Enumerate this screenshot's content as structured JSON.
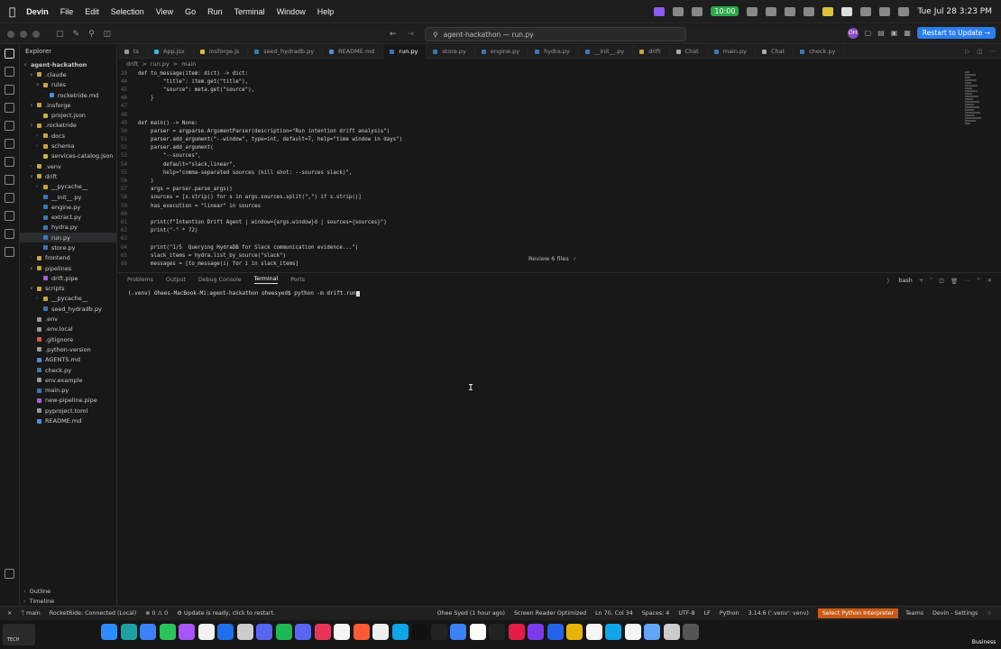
{
  "menubar": {
    "app_name": "Devin",
    "items": [
      "File",
      "Edit",
      "Selection",
      "View",
      "Go",
      "Run",
      "Terminal",
      "Window",
      "Help"
    ],
    "tray_time_badge": "10:00",
    "datetime": "Tue Jul 28  3:23 PM"
  },
  "titlebar": {
    "search_text": "agent-hackathon — run.py",
    "restart_label": "Restart to Update →",
    "avatar_initials": "OH"
  },
  "explorer": {
    "title": "Explorer",
    "tree": [
      {
        "label": "agent-hackathon",
        "indent": 0,
        "chev": "v",
        "type": "root"
      },
      {
        "label": ".claude",
        "indent": 1,
        "chev": "v",
        "type": "folder"
      },
      {
        "label": "rules",
        "indent": 2,
        "chev": "v",
        "type": "folder"
      },
      {
        "label": "rocketride.md",
        "indent": 3,
        "chev": "",
        "type": "md"
      },
      {
        "label": ".insforge",
        "indent": 1,
        "chev": "v",
        "type": "folder"
      },
      {
        "label": "project.json",
        "indent": 2,
        "chev": "",
        "type": "json"
      },
      {
        "label": ".rocketride",
        "indent": 1,
        "chev": "v",
        "type": "folder"
      },
      {
        "label": "docs",
        "indent": 2,
        "chev": ">",
        "type": "folder"
      },
      {
        "label": "schema",
        "indent": 2,
        "chev": ">",
        "type": "folder"
      },
      {
        "label": "services-catalog.json",
        "indent": 2,
        "chev": "",
        "type": "json"
      },
      {
        "label": ".venv",
        "indent": 1,
        "chev": ">",
        "type": "folder"
      },
      {
        "label": "drift",
        "indent": 1,
        "chev": "v",
        "type": "folder"
      },
      {
        "label": "__pycache__",
        "indent": 2,
        "chev": ">",
        "type": "folder"
      },
      {
        "label": "__init__.py",
        "indent": 2,
        "chev": "",
        "type": "py"
      },
      {
        "label": "engine.py",
        "indent": 2,
        "chev": "",
        "type": "py"
      },
      {
        "label": "extract.py",
        "indent": 2,
        "chev": "",
        "type": "py"
      },
      {
        "label": "hydra.py",
        "indent": 2,
        "chev": "",
        "type": "py"
      },
      {
        "label": "run.py",
        "indent": 2,
        "chev": "",
        "type": "py",
        "selected": true
      },
      {
        "label": "store.py",
        "indent": 2,
        "chev": "",
        "type": "py"
      },
      {
        "label": "frontend",
        "indent": 1,
        "chev": ">",
        "type": "folder"
      },
      {
        "label": "pipelines",
        "indent": 1,
        "chev": "v",
        "type": "folder"
      },
      {
        "label": "drift.pipe",
        "indent": 2,
        "chev": "",
        "type": "pipe"
      },
      {
        "label": "scripts",
        "indent": 1,
        "chev": "v",
        "type": "folder"
      },
      {
        "label": "__pycache__",
        "indent": 2,
        "chev": ">",
        "type": "folder"
      },
      {
        "label": "seed_hydradb.py",
        "indent": 2,
        "chev": "",
        "type": "py"
      },
      {
        "label": ".env",
        "indent": 1,
        "chev": "",
        "type": "env"
      },
      {
        "label": ".env.local",
        "indent": 1,
        "chev": "",
        "type": "env"
      },
      {
        "label": ".gitignore",
        "indent": 1,
        "chev": "",
        "type": "git"
      },
      {
        "label": ".python-version",
        "indent": 1,
        "chev": "",
        "type": "env"
      },
      {
        "label": "AGENTS.md",
        "indent": 1,
        "chev": "",
        "type": "md"
      },
      {
        "label": "check.py",
        "indent": 1,
        "chev": "",
        "type": "py"
      },
      {
        "label": "env.example",
        "indent": 1,
        "chev": "",
        "type": "env"
      },
      {
        "label": "main.py",
        "indent": 1,
        "chev": "",
        "type": "py"
      },
      {
        "label": "new-pipeline.pipe",
        "indent": 1,
        "chev": "",
        "type": "pipe"
      },
      {
        "label": "pyproject.toml",
        "indent": 1,
        "chev": "",
        "type": "env"
      },
      {
        "label": "README.md",
        "indent": 1,
        "chev": "",
        "type": "md"
      }
    ],
    "bottom_sections": [
      "Outline",
      "Timeline"
    ]
  },
  "tabs": [
    {
      "label": "ts",
      "type": "env"
    },
    {
      "label": "App.jsx",
      "type": "jsx"
    },
    {
      "label": "insforge.js",
      "type": "js"
    },
    {
      "label": "seed_hydradb.py",
      "type": "py"
    },
    {
      "label": "README.md",
      "type": "md"
    },
    {
      "label": "run.py",
      "type": "py",
      "active": true
    },
    {
      "label": "store.py",
      "type": "py"
    },
    {
      "label": "engine.py",
      "type": "py"
    },
    {
      "label": "hydra.py",
      "type": "py"
    },
    {
      "label": "__init__.py",
      "type": "py"
    },
    {
      "label": "drift",
      "type": "folder"
    },
    {
      "label": "Chat",
      "type": "chat"
    },
    {
      "label": "main.py",
      "type": "py"
    },
    {
      "label": "Chat",
      "type": "chat"
    },
    {
      "label": "check.py",
      "type": "py"
    }
  ],
  "breadcrumb": [
    "drift",
    ">",
    "run.py",
    ">",
    "main"
  ],
  "code_lines": [
    {
      "n": "29",
      "t": "def to_message(item: dict) -> dict:"
    },
    {
      "n": "44",
      "t": "        \"title\": item.get(\"title\"),"
    },
    {
      "n": "45",
      "t": "        \"source\": meta.get(\"source\"),"
    },
    {
      "n": "46",
      "t": "    }"
    },
    {
      "n": "47",
      "t": ""
    },
    {
      "n": "48",
      "t": ""
    },
    {
      "n": "49",
      "t": "def main() -> None:"
    },
    {
      "n": "50",
      "t": "    parser = argparse.ArgumentParser(description=\"Run intention drift analysis\")"
    },
    {
      "n": "51",
      "t": "    parser.add_argument(\"--window\", type=int, default=7, help=\"time window in days\")"
    },
    {
      "n": "52",
      "t": "    parser.add_argument("
    },
    {
      "n": "53",
      "t": "        \"--sources\","
    },
    {
      "n": "54",
      "t": "        default=\"slack,linear\","
    },
    {
      "n": "55",
      "t": "        help=\"comma-separated sources (kill shot: --sources slack)\","
    },
    {
      "n": "56",
      "t": "    )"
    },
    {
      "n": "57",
      "t": "    args = parser.parse_args()"
    },
    {
      "n": "58",
      "t": "    sources = [s.strip() for s in args.sources.split(\",\") if s.strip()]"
    },
    {
      "n": "59",
      "t": "    has_execution = \"linear\" in sources"
    },
    {
      "n": "60",
      "t": ""
    },
    {
      "n": "61",
      "t": "    print(f\"Intention Drift Agent | window={args.window}d | sources={sources}\")"
    },
    {
      "n": "62",
      "t": "    print(\"-\" * 72)"
    },
    {
      "n": "63",
      "t": ""
    },
    {
      "n": "64",
      "t": "    print(\"1/5  Querying HydraDB for Slack communication evidence...\")"
    },
    {
      "n": "65",
      "t": "    slack_items = hydra.list_by_source(\"slack\")"
    },
    {
      "n": "66",
      "t": "    messages = [to_message(i) for i in slack_items]"
    }
  ],
  "review": {
    "label": "Review 6 files"
  },
  "panel": {
    "tabs": [
      "Problems",
      "Output",
      "Debug Console",
      "Terminal",
      "Ports"
    ],
    "active_tab": "Terminal",
    "shell_label": "bash",
    "terminal_prompt": "(.venv) Ohees-MacBook-M1:agent-hackathon oheesyed$ python -m drift.run"
  },
  "statusbar": {
    "branch": "main",
    "rocketride": "RocketRide: Connected (Local)",
    "problems": "⊗ 0 ⚠ 0",
    "update": "Update is ready, click to restart.",
    "blame": "Ohee Syed (1 hour ago)",
    "screen_reader": "Screen Reader Optimized",
    "position": "Ln 70, Col 34",
    "spaces": "Spaces: 4",
    "encoding": "UTF-8",
    "eol": "LF",
    "language": "Python",
    "interpreter": "3.14.6 ('.venv': venv)",
    "select_interpreter": "Select Python Interpreter",
    "teams": "Teams",
    "settings": "Devin - Settings"
  },
  "dock": {
    "left_label": "TECH",
    "right_label": "Business",
    "app_colors": [
      "#2d8cff",
      "#1ba1a1",
      "#3b82f6",
      "#29c55a",
      "#a855f7",
      "#f3f3f3",
      "#1f6feb",
      "#cccccc",
      "#5865f2",
      "#1db954",
      "#5865f2",
      "#e8345a",
      "#f5f5f5",
      "#ff5a36",
      "#eeeeee",
      "#0ea5e9",
      "#111111",
      "#222222",
      "#3b82f6",
      "#ffffff",
      "#222222",
      "#e11d48",
      "#7c3aed",
      "#2563eb",
      "#eab308",
      "#f5f5f5",
      "#0ea5e9",
      "#f5f5f5",
      "#60a5fa",
      "#cccccc",
      "#555555"
    ]
  },
  "colors": {
    "accent": "#2a7ef0",
    "status_highlight": "#c95a16"
  }
}
